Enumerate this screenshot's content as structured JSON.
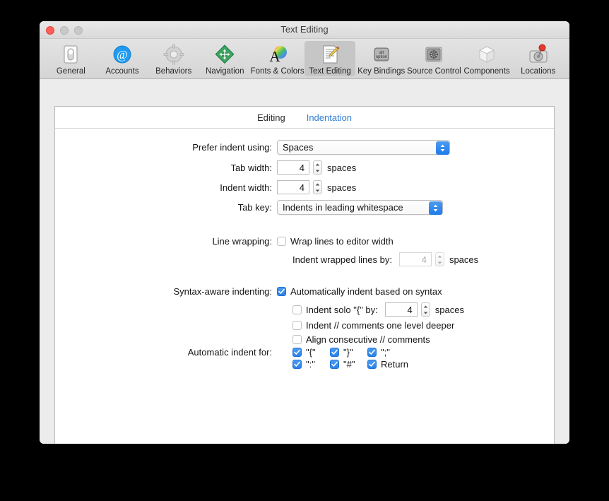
{
  "window": {
    "title": "Text Editing",
    "traffic_lights": [
      "close-button",
      "minimize-button",
      "zoom-button"
    ]
  },
  "toolbar": {
    "items": [
      {
        "label": "General",
        "icon": "general-icon",
        "selected": false
      },
      {
        "label": "Accounts",
        "icon": "accounts-icon",
        "selected": false
      },
      {
        "label": "Behaviors",
        "icon": "behaviors-icon",
        "selected": false
      },
      {
        "label": "Navigation",
        "icon": "navigation-icon",
        "selected": false
      },
      {
        "label": "Fonts & Colors",
        "icon": "fonts-colors-icon",
        "selected": false
      },
      {
        "label": "Text Editing",
        "icon": "text-editing-icon",
        "selected": true
      },
      {
        "label": "Key Bindings",
        "icon": "key-bindings-icon",
        "selected": false
      },
      {
        "label": "Source Control",
        "icon": "source-control-icon",
        "selected": false
      },
      {
        "label": "Components",
        "icon": "components-icon",
        "selected": false
      },
      {
        "label": "Locations",
        "icon": "locations-icon",
        "selected": false
      }
    ]
  },
  "tabs": [
    {
      "label": "Editing",
      "active": false
    },
    {
      "label": "Indentation",
      "active": true
    }
  ],
  "form": {
    "prefer_indent": {
      "label": "Prefer indent using:",
      "value": "Spaces"
    },
    "tab_width": {
      "label": "Tab width:",
      "value": "4",
      "unit": "spaces"
    },
    "indent_width": {
      "label": "Indent width:",
      "value": "4",
      "unit": "spaces"
    },
    "tab_key": {
      "label": "Tab key:",
      "value": "Indents in leading whitespace"
    },
    "line_wrapping": {
      "label": "Line wrapping:",
      "wrap_lines": {
        "label": "Wrap lines to editor width",
        "checked": false
      },
      "indent_wrapped": {
        "label": "Indent wrapped lines by:",
        "value": "4",
        "unit": "spaces",
        "enabled": false
      }
    },
    "syntax_aware": {
      "label": "Syntax-aware indenting:",
      "auto_indent": {
        "label": "Automatically indent based on syntax",
        "checked": true
      },
      "indent_solo": {
        "label": "Indent solo \"{\" by:",
        "checked": false,
        "value": "4",
        "unit": "spaces"
      },
      "indent_comments": {
        "label": "Indent // comments one level deeper",
        "checked": false
      },
      "align_comments": {
        "label": "Align consecutive // comments",
        "checked": false
      }
    },
    "automatic_indent": {
      "label": "Automatic indent for:",
      "rows": [
        [
          {
            "label": "\"{\"",
            "checked": true
          },
          {
            "label": "\"}\"",
            "checked": true
          },
          {
            "label": "\";\"",
            "checked": true
          }
        ],
        [
          {
            "label": "\":\"",
            "checked": true
          },
          {
            "label": "\"#\"",
            "checked": true
          },
          {
            "label": "Return",
            "checked": true
          }
        ]
      ]
    }
  },
  "colors": {
    "accent": "#2a82e8",
    "tab_active": "#2f7fd6",
    "window_bg": "#ececec",
    "panel_bg": "#ffffff"
  }
}
